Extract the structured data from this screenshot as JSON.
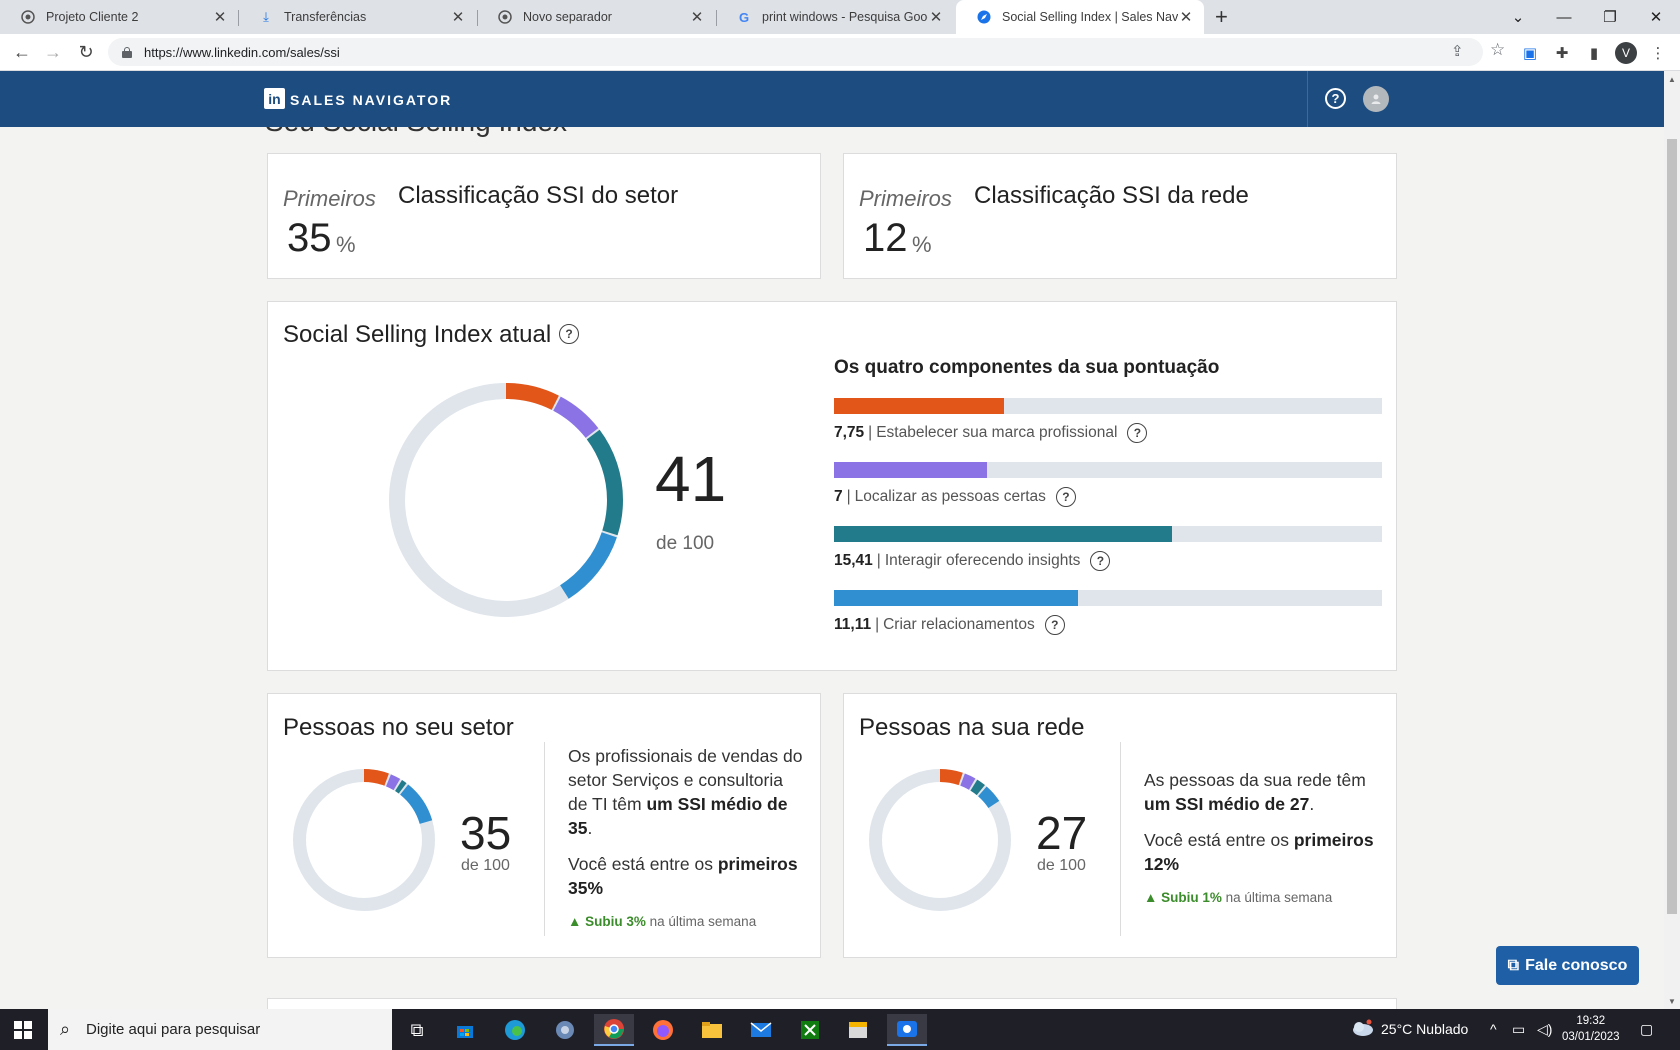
{
  "browser": {
    "tabs": [
      {
        "label": "Projeto Cliente 2",
        "icon": "chrome-icon"
      },
      {
        "label": "Transferências",
        "icon": "download-icon"
      },
      {
        "label": "Novo separador",
        "icon": "chrome-icon"
      },
      {
        "label": "print windows - Pesquisa Google",
        "icon": "google-icon"
      },
      {
        "label": "Social Selling Index | Sales Navigat",
        "icon": "compass-icon"
      }
    ],
    "url": "https://www.linkedin.com/sales/ssi",
    "profile_initial": "V"
  },
  "header": {
    "logo_text": "in",
    "title": "SALES NAVIGATOR",
    "help": "?"
  },
  "page_heading": "Seu Social Selling Index",
  "rank_cards": [
    {
      "prefix": "Primeiros",
      "title": "Classificação SSI do setor",
      "value": "35",
      "unit": "%"
    },
    {
      "prefix": "Primeiros",
      "title": "Classificação SSI da rede",
      "value": "12",
      "unit": "%"
    }
  ],
  "ssi": {
    "title": "Social Selling Index atual",
    "score": "41",
    "of_label": "de 100",
    "components_title": "Os quatro componentes da sua pontuação",
    "components": [
      {
        "value": "7,75",
        "label": "Estabelecer sua marca profissional",
        "score": 7.75,
        "max": 25,
        "color": "#e2561a"
      },
      {
        "value": "7",
        "label": "Localizar as pessoas certas",
        "score": 7,
        "max": 25,
        "color": "#8b73e6"
      },
      {
        "value": "15,41",
        "label": "Interagir oferecendo insights",
        "score": 15.41,
        "max": 25,
        "color": "#227b8b"
      },
      {
        "value": "11,11",
        "label": "Criar relacionamentos",
        "score": 11.11,
        "max": 25,
        "color": "#2f8fd0"
      }
    ]
  },
  "sector": {
    "title": "Pessoas no seu setor",
    "score": "35",
    "of_label": "de 100",
    "components": [
      6.2,
      2.8,
      1.7,
      10.3
    ],
    "text1_a": "Os profissionais de vendas do setor Serviços e consultoria de TI têm ",
    "text1_b": "um SSI médio de 35",
    "text1_c": ".",
    "text2_a": "Você está entre os ",
    "text2_b": "primeiros 35%",
    "trend_up": "Subiu 3%",
    "trend_rest": " na última semana"
  },
  "network": {
    "title": "Pessoas na sua rede",
    "score": "27",
    "of_label": "de 100",
    "components": [
      5.7,
      3.1,
      2.6,
      4.8
    ],
    "text1_a": "As pessoas da sua rede têm ",
    "text1_b": "um SSI médio de 27",
    "text1_c": ".",
    "text2_a": "Você está entre os ",
    "text2_b": "primeiros 12%",
    "trend_up": "Subiu 1%",
    "trend_rest": " na última semana"
  },
  "contact_button": "Fale conosco",
  "taskbar": {
    "search_placeholder": "Digite aqui para pesquisar",
    "weather": "25°C  Nublado",
    "time": "19:32",
    "date": "03/01/2023"
  },
  "colors": {
    "orange": "#e2561a",
    "purple": "#8b73e6",
    "teal": "#227b8b",
    "blue": "#2f8fd0",
    "track": "#dfe5eb",
    "header": "#1d4d80"
  }
}
